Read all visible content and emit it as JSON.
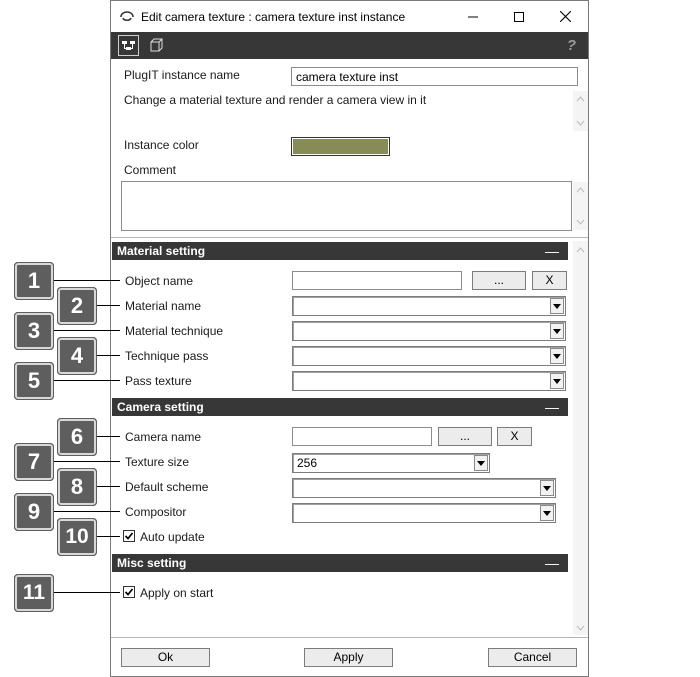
{
  "window": {
    "title": "Edit camera texture : camera texture inst instance",
    "minimize": "—",
    "maximize": "☐",
    "close": "✕"
  },
  "toolbar": {
    "help": "?"
  },
  "instance": {
    "name_label": "PlugIT instance name",
    "name_value": "camera texture inst",
    "description": "Change a material texture and render a camera view in it",
    "color_label": "Instance color",
    "color_value": "#878c56",
    "comment_label": "Comment"
  },
  "material_setting": {
    "header": "Material setting",
    "collapse": "—",
    "object_name_label": "Object name",
    "browse_label": "...",
    "clear_label": "X",
    "material_name_label": "Material name",
    "material_technique_label": "Material technique",
    "technique_pass_label": "Technique pass",
    "pass_texture_label": "Pass texture"
  },
  "camera_setting": {
    "header": "Camera setting",
    "collapse": "—",
    "camera_name_label": "Camera name",
    "browse_label": "...",
    "clear_label": "X",
    "texture_size_label": "Texture size",
    "texture_size_value": "256",
    "default_scheme_label": "Default scheme",
    "compositor_label": "Compositor",
    "auto_update_label": "Auto update",
    "auto_update_checked": true
  },
  "misc_setting": {
    "header": "Misc setting",
    "collapse": "—",
    "apply_on_start_label": "Apply on start",
    "apply_on_start_checked": true
  },
  "footer": {
    "ok": "Ok",
    "apply": "Apply",
    "cancel": "Cancel"
  },
  "callouts": [
    "1",
    "2",
    "3",
    "4",
    "5",
    "6",
    "7",
    "8",
    "9",
    "10",
    "11"
  ]
}
